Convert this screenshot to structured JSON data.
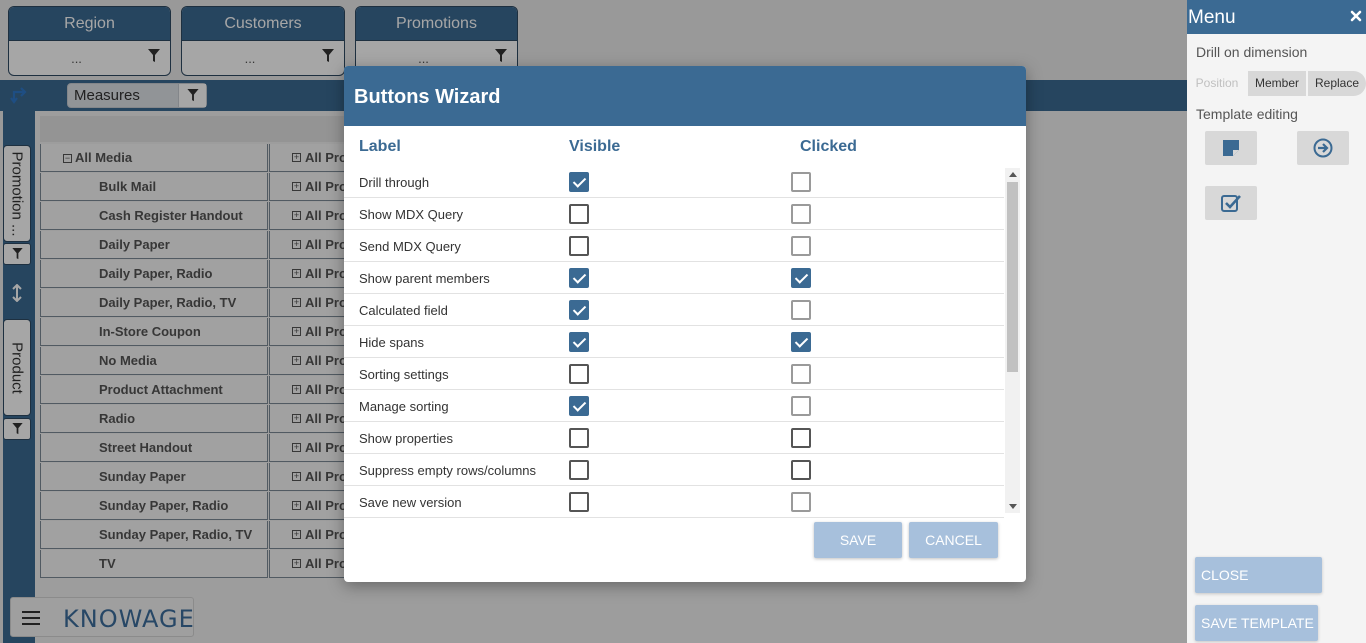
{
  "filters": [
    {
      "label": "Region",
      "value": "..."
    },
    {
      "label": "Customers",
      "value": "..."
    },
    {
      "label": "Promotions",
      "value": "..."
    }
  ],
  "toolbar": {
    "measures_label": "Measures"
  },
  "rail": {
    "promotion_label": "Promotion ...",
    "product_label": "Product"
  },
  "pivot": {
    "root_label": "All Media",
    "root_member": "All Pro",
    "rows": [
      {
        "label": "Bulk Mail",
        "member": "All Pro"
      },
      {
        "label": "Cash Register Handout",
        "member": "All Pro"
      },
      {
        "label": "Daily Paper",
        "member": "All Pro"
      },
      {
        "label": "Daily Paper, Radio",
        "member": "All Pro"
      },
      {
        "label": "Daily Paper, Radio, TV",
        "member": "All Pro"
      },
      {
        "label": "In-Store Coupon",
        "member": "All Pro"
      },
      {
        "label": "No Media",
        "member": "All Pro"
      },
      {
        "label": "Product Attachment",
        "member": "All Pro"
      },
      {
        "label": "Radio",
        "member": "All Pro"
      },
      {
        "label": "Street Handout",
        "member": "All Pro"
      },
      {
        "label": "Sunday Paper",
        "member": "All Pro"
      },
      {
        "label": "Sunday Paper, Radio",
        "member": "All Pro"
      },
      {
        "label": "Sunday Paper, Radio, TV",
        "member": "All Pro"
      },
      {
        "label": "TV",
        "member": "All Pro"
      }
    ]
  },
  "brand": {
    "logo_text": "KNOWAGE"
  },
  "dialog": {
    "title": "Buttons Wizard",
    "columns": {
      "label": "Label",
      "visible": "Visible",
      "clicked": "Clicked"
    },
    "rows": [
      {
        "label": "Drill through",
        "visible": true,
        "clicked": false,
        "clicked_enabled": false
      },
      {
        "label": "Show MDX Query",
        "visible": false,
        "clicked": false,
        "clicked_enabled": false
      },
      {
        "label": "Send MDX Query",
        "visible": false,
        "clicked": false,
        "clicked_enabled": false
      },
      {
        "label": "Show parent members",
        "visible": true,
        "clicked": true,
        "clicked_enabled": true
      },
      {
        "label": "Calculated field",
        "visible": true,
        "clicked": false,
        "clicked_enabled": false
      },
      {
        "label": "Hide spans",
        "visible": true,
        "clicked": true,
        "clicked_enabled": true
      },
      {
        "label": "Sorting settings",
        "visible": false,
        "clicked": false,
        "clicked_enabled": false
      },
      {
        "label": "Manage sorting",
        "visible": true,
        "clicked": false,
        "clicked_enabled": false
      },
      {
        "label": "Show properties",
        "visible": false,
        "clicked": false,
        "clicked_enabled": true
      },
      {
        "label": "Suppress empty rows/columns",
        "visible": false,
        "clicked": false,
        "clicked_enabled": true
      },
      {
        "label": "Save new version",
        "visible": false,
        "clicked": false,
        "clicked_enabled": false
      }
    ],
    "save_label": "SAVE",
    "cancel_label": "CANCEL"
  },
  "menu": {
    "title": "Menu",
    "drill_label": "Drill on dimension",
    "drill_options": [
      "Position",
      "Member",
      "Replace"
    ],
    "template_label": "Template editing",
    "close_designer_label": "CLOSE DESIGNER",
    "save_template_label": "SAVE TEMPLATE"
  },
  "colors": {
    "primary": "#3b6a93",
    "button_disabled": "#a7c0dc"
  }
}
